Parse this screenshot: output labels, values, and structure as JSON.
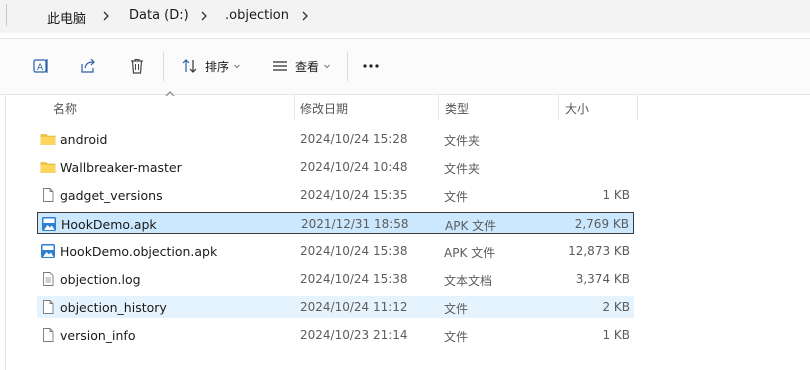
{
  "breadcrumb": {
    "items": [
      "此电脑",
      "Data (D:)",
      ".objection"
    ]
  },
  "toolbar": {
    "sort_label": "排序",
    "view_label": "查看",
    "more_label": "···"
  },
  "columns": {
    "name": "名称",
    "date": "修改日期",
    "type": "类型",
    "size": "大小"
  },
  "files": [
    {
      "name": "android",
      "date": "2024/10/24 15:28",
      "type": "文件夹",
      "size": "",
      "icon": "folder-icon"
    },
    {
      "name": "Wallbreaker-master",
      "date": "2024/10/24 10:48",
      "type": "文件夹",
      "size": "",
      "icon": "folder-icon"
    },
    {
      "name": "gadget_versions",
      "date": "2024/10/24 15:35",
      "type": "文件",
      "size": "1 KB",
      "icon": "file-icon"
    },
    {
      "name": "HookDemo.apk",
      "date": "2021/12/31 18:58",
      "type": "APK 文件",
      "size": "2,769 KB",
      "icon": "apk-icon",
      "state": "selected"
    },
    {
      "name": "HookDemo.objection.apk",
      "date": "2024/10/24 15:38",
      "type": "APK 文件",
      "size": "12,873 KB",
      "icon": "apk-icon"
    },
    {
      "name": "objection.log",
      "date": "2024/10/24 15:38",
      "type": "文本文档",
      "size": "3,374 KB",
      "icon": "text-file-icon"
    },
    {
      "name": "objection_history",
      "date": "2024/10/24 11:12",
      "type": "文件",
      "size": "2 KB",
      "icon": "file-icon",
      "state": "hover"
    },
    {
      "name": "version_info",
      "date": "2024/10/23 21:14",
      "type": "文件",
      "size": "1 KB",
      "icon": "file-icon"
    }
  ],
  "colors": {
    "selected_bg": "#cce8ff",
    "hover_bg": "#e5f3ff",
    "folder": "#f4c542",
    "apk": "#2f7fd1"
  }
}
